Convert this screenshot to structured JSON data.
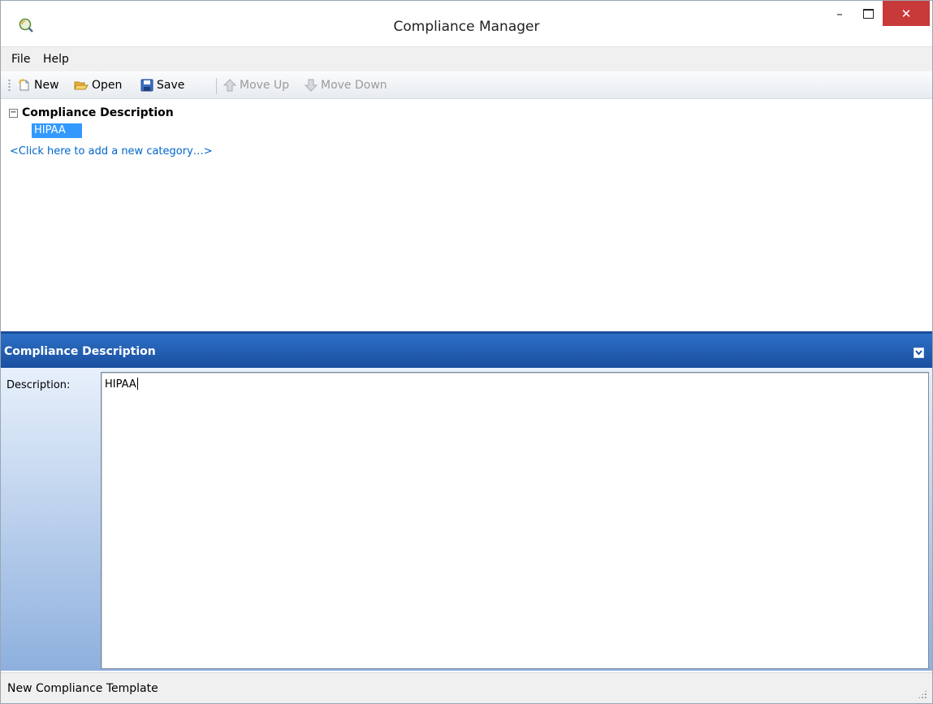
{
  "window": {
    "title": "Compliance Manager",
    "minimize_glyph": "–",
    "close_glyph": "✕"
  },
  "menu": {
    "items": [
      {
        "label": "File"
      },
      {
        "label": "Help"
      }
    ]
  },
  "toolbar": {
    "new_label": "New",
    "open_label": "Open",
    "save_label": "Save",
    "move_up_label": "Move Up",
    "move_down_label": "Move Down"
  },
  "tree": {
    "expander": "−",
    "root_label": "Compliance Description",
    "children": [
      {
        "label": "HIPAA",
        "selected": true
      }
    ],
    "add_link_text": "<Click here to add a new category…>"
  },
  "panel": {
    "title": "Compliance Description",
    "description_label": "Description:",
    "description_value": "HIPAA"
  },
  "status": {
    "text": "New Compliance Template"
  },
  "colors": {
    "panel_header": "#1f59ad",
    "selection": "#3399ff",
    "link": "#0066cc",
    "close_button": "#c8393a"
  }
}
